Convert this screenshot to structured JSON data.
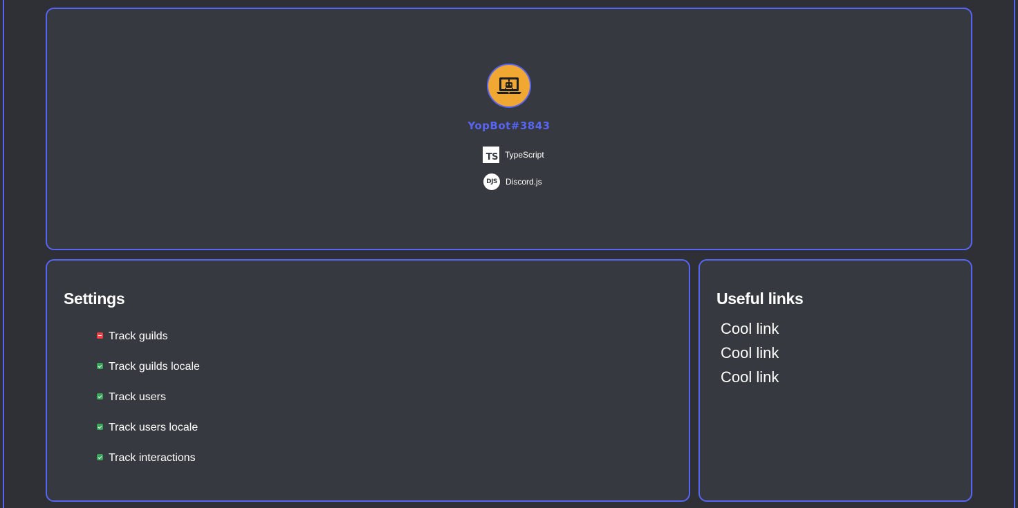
{
  "bot": {
    "name": "YopBot#3843",
    "technologies": [
      {
        "icon": "typescript-icon",
        "icon_text": "TS",
        "label": "TypeScript"
      },
      {
        "icon": "discordjs-icon",
        "icon_text": "DJS",
        "label": "Discord.js"
      }
    ]
  },
  "settings": {
    "title": "Settings",
    "items": [
      {
        "label": "Track guilds",
        "enabled": false
      },
      {
        "label": "Track guilds locale",
        "enabled": true
      },
      {
        "label": "Track users",
        "enabled": true
      },
      {
        "label": "Track users locale",
        "enabled": true
      },
      {
        "label": "Track interactions",
        "enabled": true
      }
    ]
  },
  "links": {
    "title": "Useful links",
    "items": [
      "Cool link",
      "Cool link",
      "Cool link"
    ]
  },
  "colors": {
    "accent": "#5865f2",
    "card": "#36393f",
    "background": "#2e3035",
    "avatar": "#f0a832",
    "enabled": "#3ba55c",
    "disabled": "#ed4245"
  }
}
